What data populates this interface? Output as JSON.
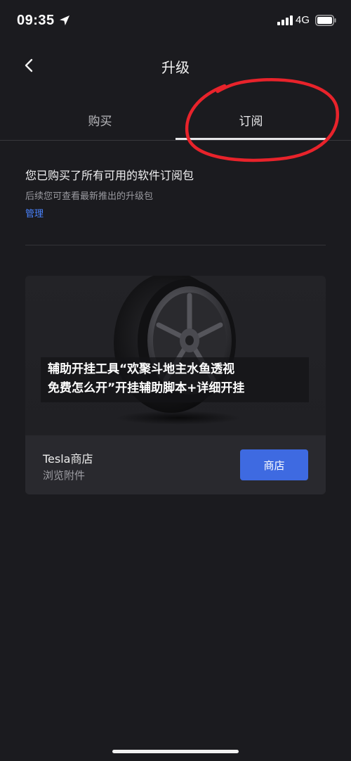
{
  "status_bar": {
    "time": "09:35",
    "network": "4G",
    "icons": [
      "location-arrow-icon",
      "signal-bars-icon",
      "battery-icon"
    ]
  },
  "header": {
    "title": "升级",
    "back_icon": "chevron-left-icon"
  },
  "tabs": [
    {
      "label": "购买",
      "active": false
    },
    {
      "label": "订阅",
      "active": true
    }
  ],
  "subscription": {
    "heading": "您已购买了所有可用的软件订阅包",
    "subtitle": "后续您可查看最新推出的升级包",
    "manage_label": "管理"
  },
  "store_card": {
    "image": "wheel-image",
    "name": "Tesla商店",
    "subtitle": "浏览附件",
    "button_label": "商店"
  },
  "overlay_caption": {
    "line1": "辅助开挂工具“欢聚斗地主水鱼透视",
    "line2": "免费怎么开”开挂辅助脚本+详细开挂"
  },
  "colors": {
    "background": "#1b1b1f",
    "accent_blue": "#3e6ae1",
    "link_blue": "#4a84ff",
    "annotation_red": "#e8232b"
  }
}
